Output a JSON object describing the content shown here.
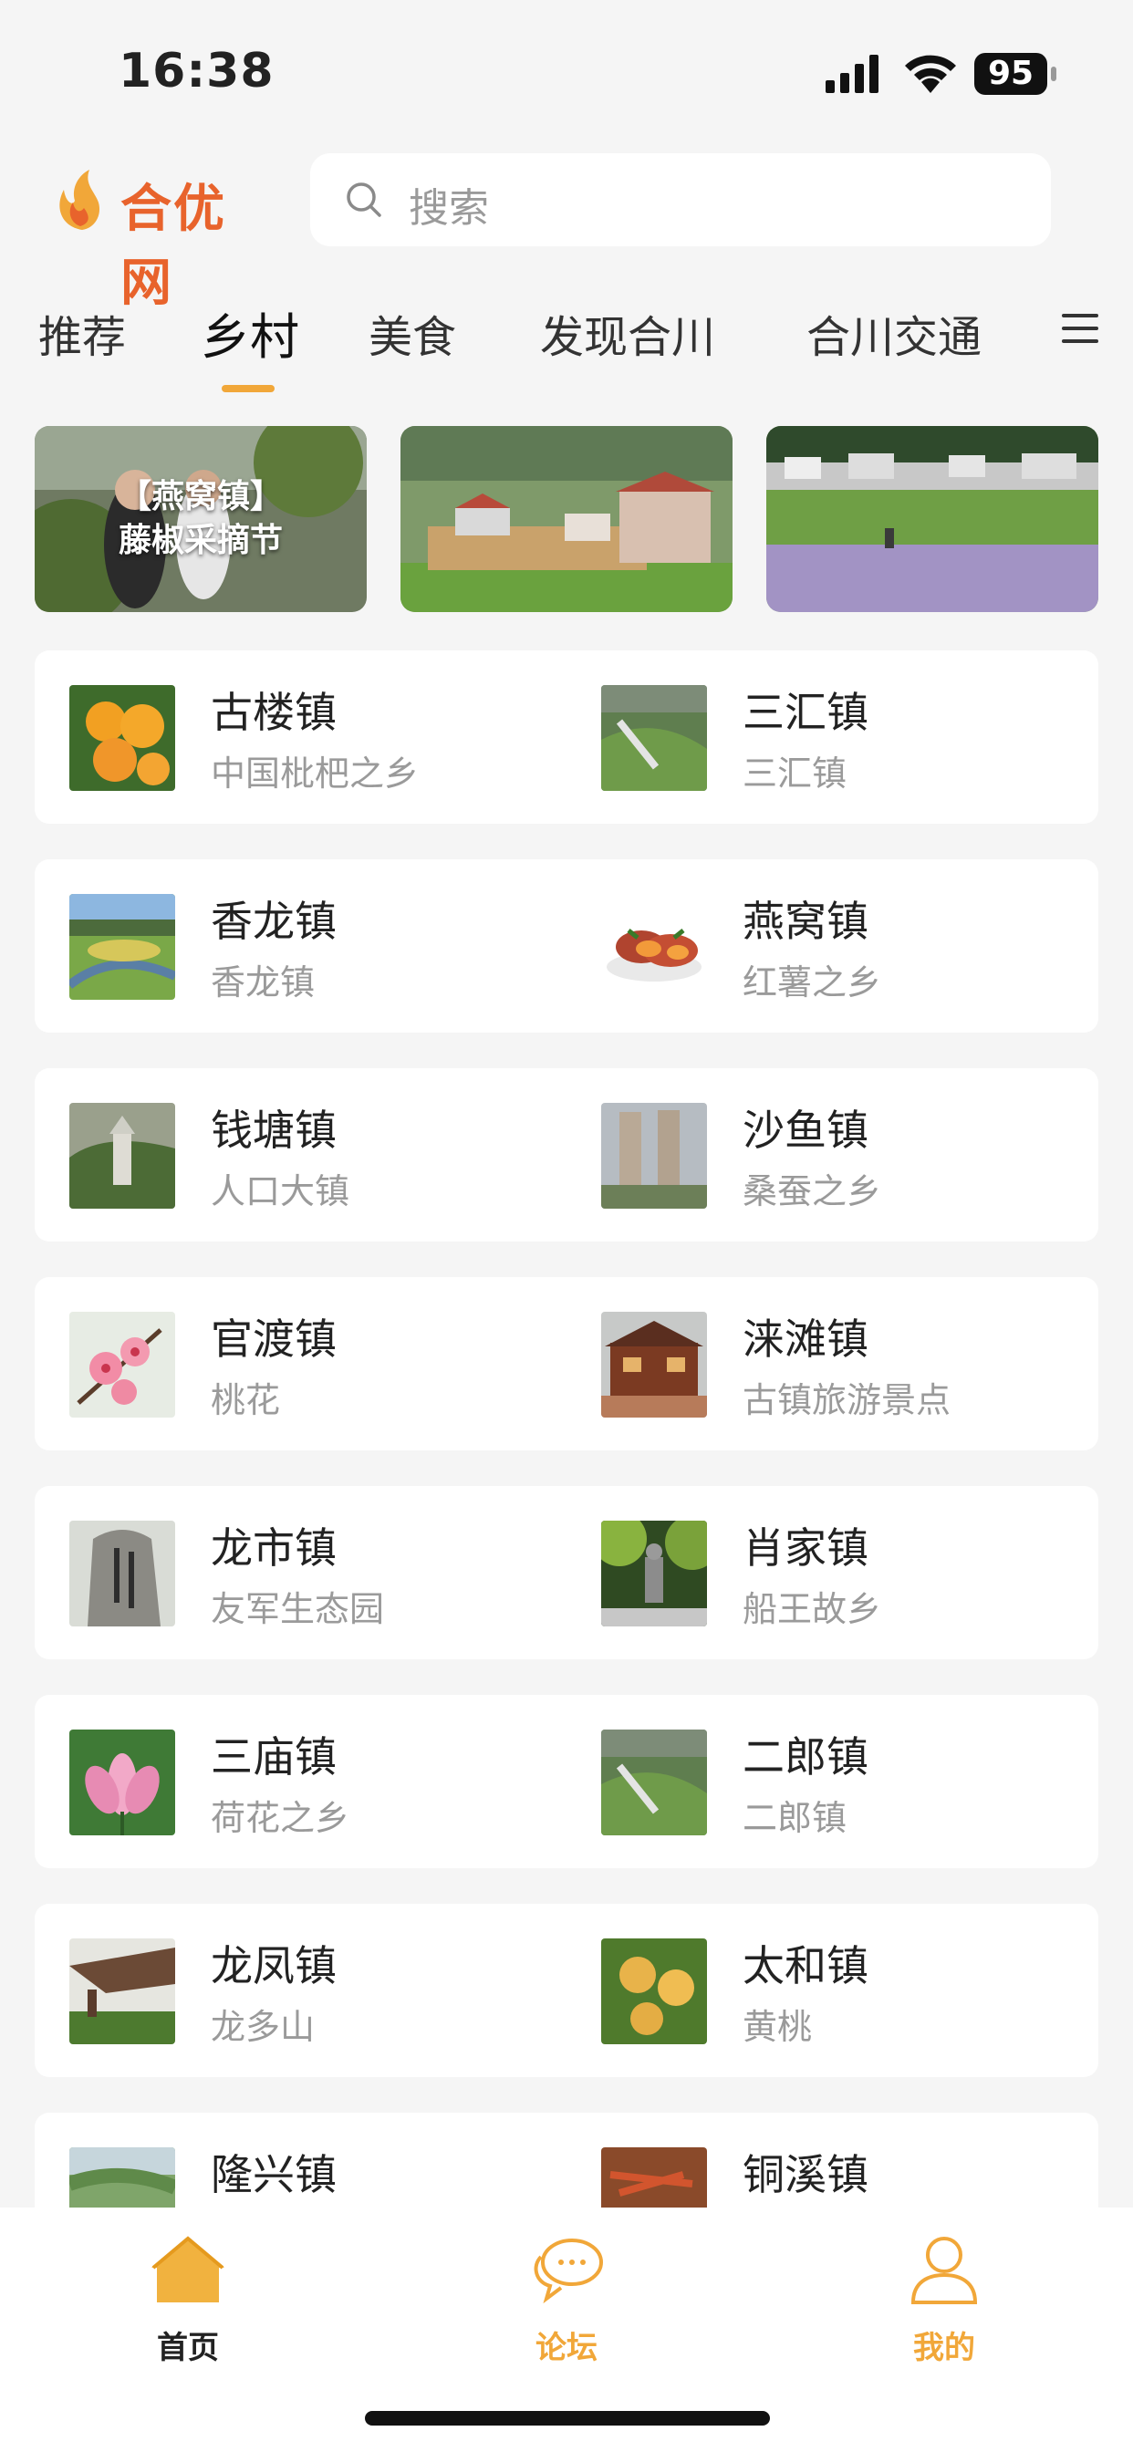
{
  "status_bar": {
    "time": "16:38",
    "battery": "95"
  },
  "header": {
    "logo_text": "合优网",
    "search_placeholder": "搜索"
  },
  "tabs": [
    {
      "label": "推荐"
    },
    {
      "label": "乡村",
      "active": true
    },
    {
      "label": "美食"
    },
    {
      "label": "发现合川"
    },
    {
      "label": "合川交通"
    }
  ],
  "banners": [
    {
      "caption_line1": "【燕窝镇】",
      "caption_line2": "藤椒采摘节"
    },
    {
      "caption_line1": "",
      "caption_line2": ""
    },
    {
      "caption_line1": "",
      "caption_line2": ""
    }
  ],
  "towns": [
    {
      "name": "古楼镇",
      "desc": "中国枇杷之乡"
    },
    {
      "name": "三汇镇",
      "desc": "三汇镇"
    },
    {
      "name": "香龙镇",
      "desc": "香龙镇"
    },
    {
      "name": "燕窝镇",
      "desc": "红薯之乡"
    },
    {
      "name": "钱塘镇",
      "desc": "人口大镇"
    },
    {
      "name": "沙鱼镇",
      "desc": "桑蚕之乡"
    },
    {
      "name": "官渡镇",
      "desc": "桃花"
    },
    {
      "name": "涞滩镇",
      "desc": "古镇旅游景点"
    },
    {
      "name": "龙市镇",
      "desc": "友军生态园"
    },
    {
      "name": "肖家镇",
      "desc": "船王故乡"
    },
    {
      "name": "三庙镇",
      "desc": "荷花之乡"
    },
    {
      "name": "二郎镇",
      "desc": "二郎镇"
    },
    {
      "name": "龙凤镇",
      "desc": "龙多山"
    },
    {
      "name": "太和镇",
      "desc": "黄桃"
    },
    {
      "name": "隆兴镇",
      "desc": ""
    },
    {
      "name": "铜溪镇",
      "desc": ""
    }
  ],
  "bottom_nav": [
    {
      "label": "首页",
      "icon": "home-icon",
      "active": true
    },
    {
      "label": "论坛",
      "icon": "chat-icon"
    },
    {
      "label": "我的",
      "icon": "user-icon"
    }
  ],
  "colors": {
    "accent": "#f1a739",
    "logo": "#e8632c",
    "background": "#f5f5f5"
  }
}
